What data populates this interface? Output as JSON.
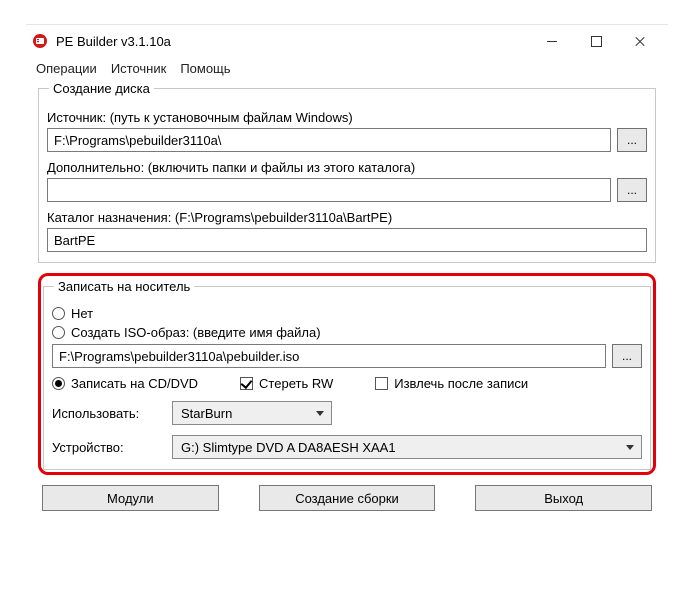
{
  "title": "PE Builder v3.1.10a",
  "menu": {
    "operations": "Операции",
    "source": "Источник",
    "help": "Помощь"
  },
  "group_disc": {
    "legend": "Создание диска",
    "source_label": "Источник: (путь к установочным файлам Windows)",
    "source_value": "F:\\Programs\\pebuilder3110a\\",
    "extra_label": "Дополнительно: (включить папки и файлы из этого каталога)",
    "extra_value": "",
    "output_label": "Каталог назначения: (F:\\Programs\\pebuilder3110a\\BartPE)",
    "output_value": "BartPE",
    "browse": "..."
  },
  "group_write": {
    "legend": "Записать на носитель",
    "opt_none": "Нет",
    "opt_iso": "Создать ISO-образ: (введите имя файла)",
    "iso_value": "F:\\Programs\\pebuilder3110a\\pebuilder.iso",
    "opt_cddvd": "Записать на CD/DVD",
    "erase_rw": "Стереть RW",
    "eject_after": "Извлечь после записи",
    "use_label": "Использовать:",
    "use_value": "StarBurn",
    "device_label": "Устройство:",
    "device_value": "G:) Slimtype DVD A  DA8AESH   XAA1",
    "browse": "..."
  },
  "buttons": {
    "modules": "Модули",
    "build": "Создание сборки",
    "exit": "Выход"
  }
}
